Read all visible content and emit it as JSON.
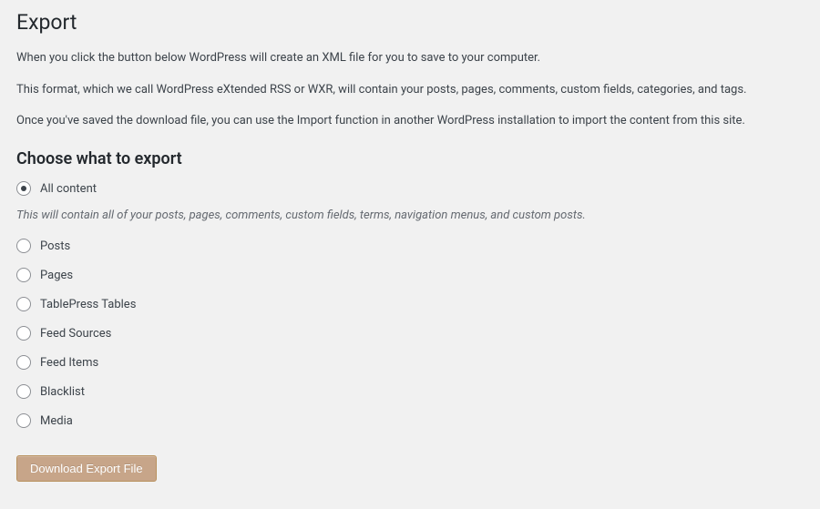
{
  "page_title": "Export",
  "intro_paragraphs": [
    "When you click the button below WordPress will create an XML file for you to save to your computer.",
    "This format, which we call WordPress eXtended RSS or WXR, will contain your posts, pages, comments, custom fields, categories, and tags.",
    "Once you've saved the download file, you can use the Import function in another WordPress installation to import the content from this site."
  ],
  "section_title": "Choose what to export",
  "options": {
    "all": {
      "label": "All content",
      "checked": true
    },
    "all_description": "This will contain all of your posts, pages, comments, custom fields, terms, navigation menus, and custom posts.",
    "posts": {
      "label": "Posts",
      "checked": false
    },
    "pages": {
      "label": "Pages",
      "checked": false
    },
    "tablepress": {
      "label": "TablePress Tables",
      "checked": false
    },
    "feed_sources": {
      "label": "Feed Sources",
      "checked": false
    },
    "feed_items": {
      "label": "Feed Items",
      "checked": false
    },
    "blacklist": {
      "label": "Blacklist",
      "checked": false
    },
    "media": {
      "label": "Media",
      "checked": false
    }
  },
  "button_label": "Download Export File"
}
